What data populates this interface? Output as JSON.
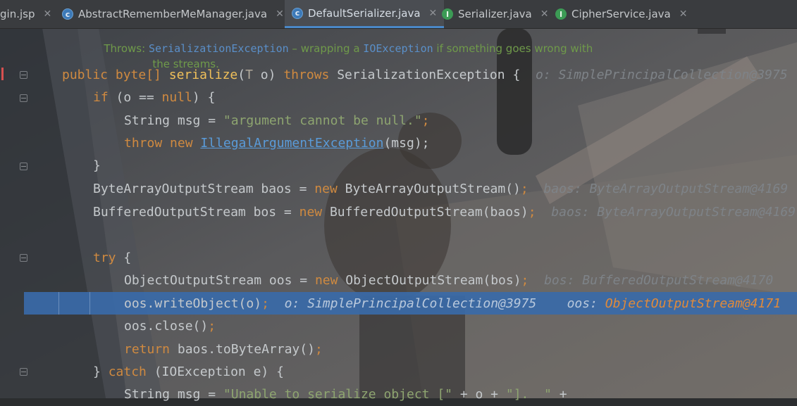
{
  "tabs": [
    {
      "label": "gin.jsp",
      "icon": "jsp-file-icon",
      "active": false
    },
    {
      "label": "AbstractRememberMeManager.java",
      "icon": "abstract-class-icon",
      "active": false
    },
    {
      "label": "DefaultSerializer.java",
      "icon": "class-icon",
      "active": true
    },
    {
      "label": "Serializer.java",
      "icon": "interface-icon",
      "active": false
    },
    {
      "label": "CipherService.java",
      "icon": "interface-icon",
      "active": false
    }
  ],
  "doc": {
    "throws_label": "Throws:",
    "exception": "SerializationException",
    "text1": " – wrapping a ",
    "ioexception": "IOException",
    "text2": " if something goes wrong with",
    "text3": "the streams."
  },
  "code": {
    "l1_public": "public",
    "l1_byte": " byte[] ",
    "l1_serialize": "serialize",
    "l1_paren": "(",
    "l1_T": "T",
    "l1_o": " o) ",
    "l1_throws": "throws",
    "l1_rest": " SerializationException {",
    "l1_hint": "o: SimplePrincipalCollection@3975",
    "l2_if": "if",
    "l2_mid": " (o == ",
    "l2_null": "null",
    "l2_end": ") {",
    "l3_a": "String msg = ",
    "l3_str": "\"argument cannot be null.\"",
    "l3_semi": ";",
    "l4_throw": "throw",
    "l4_new": " new ",
    "l4_exc": "IllegalArgumentException",
    "l4_end": "(msg);",
    "l5": "}",
    "l6_a": "ByteArrayOutputStream baos = ",
    "l6_new": "new",
    "l6_b": " ByteArrayOutputStream()",
    "l6_semi": ";",
    "l6_hint": "baos: ByteArrayOutputStream@4169",
    "l7_a": "BufferedOutputStream bos = ",
    "l7_new": "new",
    "l7_b": " BufferedOutputStream(baos)",
    "l7_semi": ";",
    "l7_hint": "baos: ByteArrayOutputStream@4169",
    "l8_try": "try",
    "l8_end": " {",
    "l9_a": "ObjectOutputStream oos = ",
    "l9_new": "new",
    "l9_b": " ObjectOutputStream(bos)",
    "l9_semi": ";",
    "l9_hint": "bos: BufferedOutputStream@4170",
    "l10_a": "oos.writeObject(o)",
    "l10_semi": ";",
    "l10_hint1": "o: SimplePrincipalCollection@3975",
    "l10_hint2_label": "oos: ",
    "l10_hint2_val": "ObjectOutputStream@4171",
    "l11_a": "oos.close()",
    "l11_semi": ";",
    "l12_return": "return",
    "l12_b": " baos.toByteArray()",
    "l12_semi": ";",
    "l13_a": "} ",
    "l13_catch": "catch",
    "l13_b": " (IOException e) {",
    "l14_a": "String msg = ",
    "l14_str": "\"Unable to serialize object [\"",
    "l14_b": " + o + ",
    "l14_str2": "\"].  \"",
    "l14_c": " +"
  }
}
